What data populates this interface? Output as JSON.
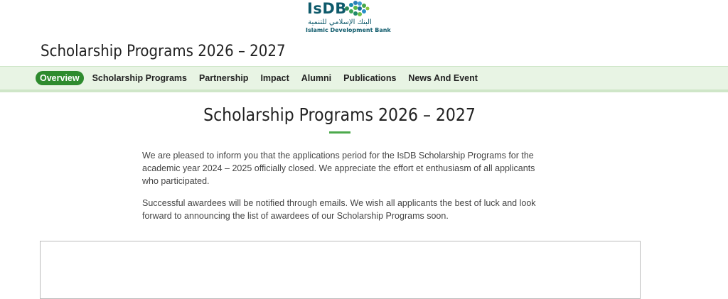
{
  "logo": {
    "name": "IsDB",
    "arabic": "البنك الإسلامي للتنمية",
    "english": "Islamic Development Bank"
  },
  "site_title": "Scholarship Programs 2026 – 2027",
  "nav": {
    "items": [
      {
        "label": "Overview",
        "active": true
      },
      {
        "label": "Scholarship Programs",
        "active": false
      },
      {
        "label": "Partnership",
        "active": false
      },
      {
        "label": "Impact",
        "active": false
      },
      {
        "label": "Alumni",
        "active": false
      },
      {
        "label": "Publications",
        "active": false
      },
      {
        "label": "News And Event",
        "active": false
      }
    ]
  },
  "main": {
    "heading": "Scholarship Programs 2026 – 2027",
    "paragraphs": [
      "We are pleased to inform you that the applications period for the IsDB Scholarship Programs for the academic year 2024 – 2025 officially closed.  We appreciate the effort et enthusiasm of all applicants who participated.",
      "Successful awardees will be notified through emails. We wish all applicants the best of luck and look forward to announcing the list of awardees of our Scholarship Programs soon."
    ]
  },
  "colors": {
    "accent_green": "#2e8b2e",
    "nav_background": "#e8f4e4",
    "logo_teal": "#0e5a6b"
  }
}
